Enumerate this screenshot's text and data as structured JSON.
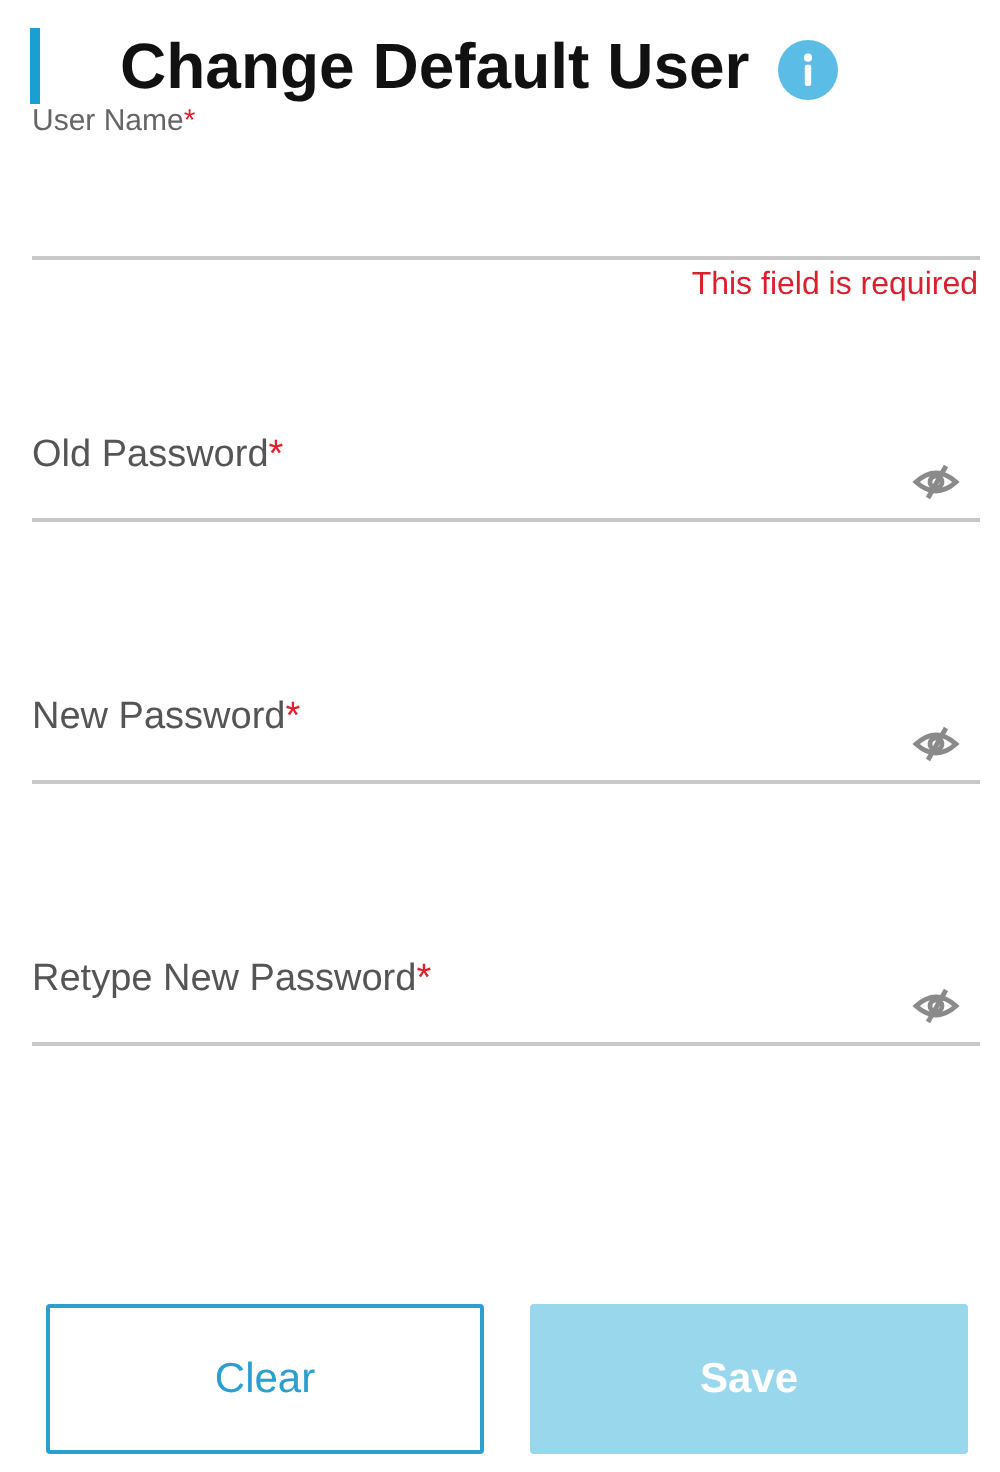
{
  "title": "Change Default User",
  "fields": [
    {
      "kind": "text",
      "label": "User Name",
      "required": true,
      "floated": true,
      "error": "This field is required"
    },
    {
      "kind": "password",
      "label": "Old Password",
      "required": true,
      "floated": false
    },
    {
      "kind": "password",
      "label": "New Password",
      "required": true,
      "floated": false
    },
    {
      "kind": "password",
      "label": "Retype New Password",
      "required": true,
      "floated": false
    }
  ],
  "required_mark": "*",
  "buttons": [
    {
      "label": "Clear",
      "kind": "outline",
      "disabled": false
    },
    {
      "label": "Save",
      "kind": "primary",
      "disabled": true
    }
  ]
}
